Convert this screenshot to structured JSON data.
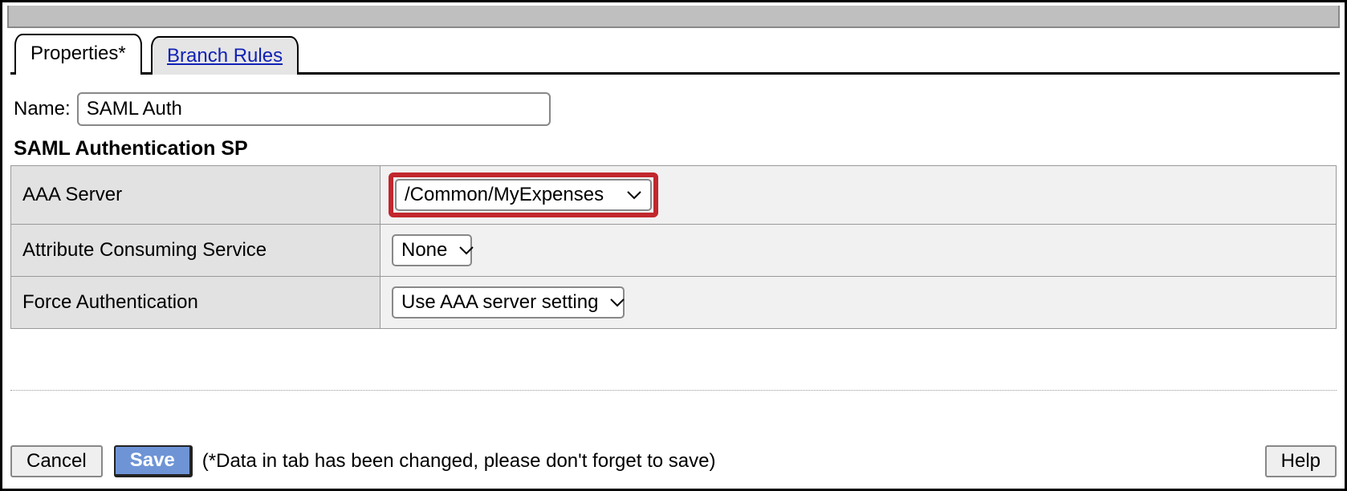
{
  "tabs": {
    "properties": "Properties*",
    "branch_rules": "Branch Rules"
  },
  "name": {
    "label": "Name:",
    "value": "SAML Auth"
  },
  "section_title": "SAML Authentication SP",
  "rows": {
    "aaa_server": {
      "label": "AAA Server",
      "value": "/Common/MyExpenses"
    },
    "acs": {
      "label": "Attribute Consuming Service",
      "value": "None"
    },
    "force_auth": {
      "label": "Force Authentication",
      "value": "Use AAA server setting"
    }
  },
  "footer": {
    "cancel": "Cancel",
    "save": "Save",
    "hint": "(*Data in tab has been changed, please don't forget to save)",
    "help": "Help"
  }
}
